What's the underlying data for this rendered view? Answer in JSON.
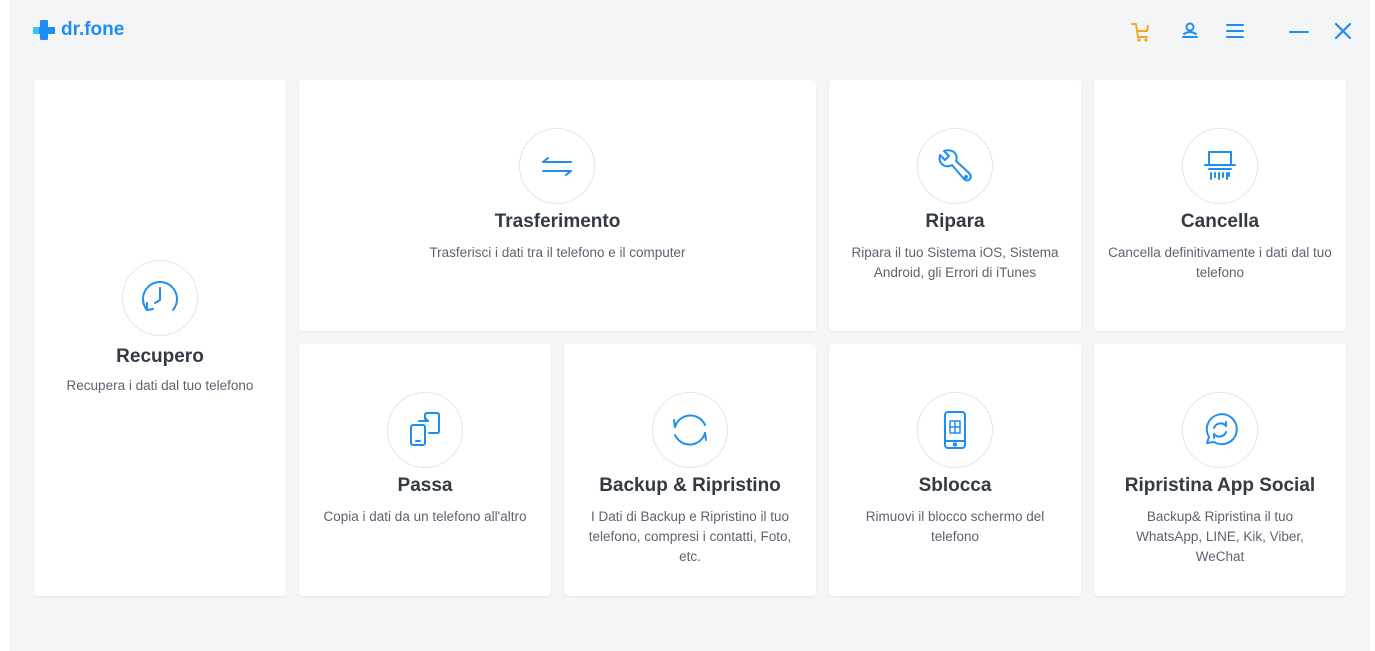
{
  "app": {
    "name": "dr.fone"
  },
  "colors": {
    "accent": "#1f8ef1",
    "cart": "#f5a623",
    "title": "#333a44",
    "desc": "#5c6370"
  },
  "titlebar": {
    "icons": [
      "cart-icon",
      "user-icon",
      "menu-icon",
      "minimize-icon",
      "close-icon"
    ]
  },
  "cards": {
    "recupero": {
      "title": "Recupero",
      "desc": "Recupera i dati dal tuo telefono",
      "icon": "clock-restore-icon"
    },
    "trasferimento": {
      "title": "Trasferimento",
      "desc": "Trasferisci i dati tra il telefono e il computer",
      "icon": "transfer-arrows-icon"
    },
    "ripara": {
      "title": "Ripara",
      "desc": "Ripara il tuo Sistema iOS, Sistema Android, gli Errori di iTunes",
      "icon": "wrench-icon"
    },
    "cancella": {
      "title": "Cancella",
      "desc": "Cancella definitivamente i dati dal tuo telefono",
      "icon": "shredder-icon"
    },
    "passa": {
      "title": "Passa",
      "desc": "Copia i dati da un telefono all'altro",
      "icon": "phone-switch-icon"
    },
    "backup": {
      "title": "Backup & Ripristino",
      "desc": "I Dati di Backup e Ripristino il tuo telefono, compresi i contatti, Foto, etc.",
      "icon": "sync-icon"
    },
    "sblocca": {
      "title": "Sblocca",
      "desc": "Rimuovi il blocco schermo del telefono",
      "icon": "phone-unlock-icon"
    },
    "social": {
      "title": "Ripristina App Social",
      "desc": "Backup& Ripristina il tuo WhatsApp, LINE, Kik, Viber, WeChat",
      "icon": "chat-restore-icon"
    }
  }
}
